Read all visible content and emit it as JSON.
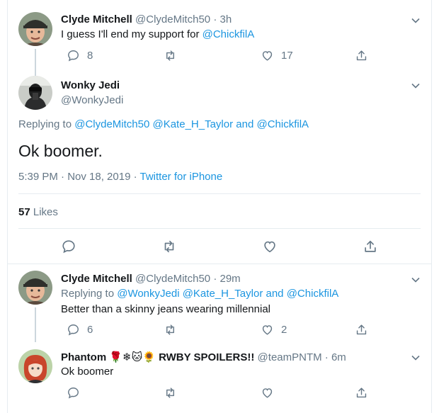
{
  "tweets": [
    {
      "name": "Clyde Mitchell",
      "handle": "@ClydeMitch50",
      "dot": "·",
      "time": "3h",
      "text_prefix": "I guess I'll end my support for ",
      "text_link": "@ChickfilA",
      "replies": "8",
      "retweets": "",
      "likes": "17"
    },
    {
      "name": "Clyde Mitchell",
      "handle": "@ClydeMitch50",
      "dot": "·",
      "time": "29m",
      "replying_label": "Replying to ",
      "replying_to": "@WonkyJedi @Kate_H_Taylor",
      "replying_and": " and ",
      "replying_last": "@ChickfilA",
      "text": "Better than a skinny jeans wearing millennial",
      "replies": "6",
      "retweets": "",
      "likes": "2"
    },
    {
      "name": "Phantom",
      "name_emoji": "🌹❄🐱🌻",
      "name_suffix": " RWBY SPOILERS!!",
      "handle": "@teamPNTM",
      "dot": "·",
      "time": "6m",
      "text": "Ok boomer",
      "replies": "",
      "retweets": "",
      "likes": ""
    }
  ],
  "main": {
    "name": "Wonky Jedi",
    "handle": "@WonkyJedi",
    "replying_label": "Replying to ",
    "replying_to": "@ClydeMitch50 @Kate_H_Taylor",
    "replying_and": " and ",
    "replying_last": "@ChickfilA",
    "text": "Ok boomer.",
    "time": "5:39 PM · Nov 18, 2019 · ",
    "source": "Twitter for iPhone",
    "likes_count": "57",
    "likes_label": " Likes"
  },
  "colors": {
    "accent": "#1b95e0",
    "muted": "#657786",
    "text": "#14171a",
    "border": "#e6ecf0"
  }
}
